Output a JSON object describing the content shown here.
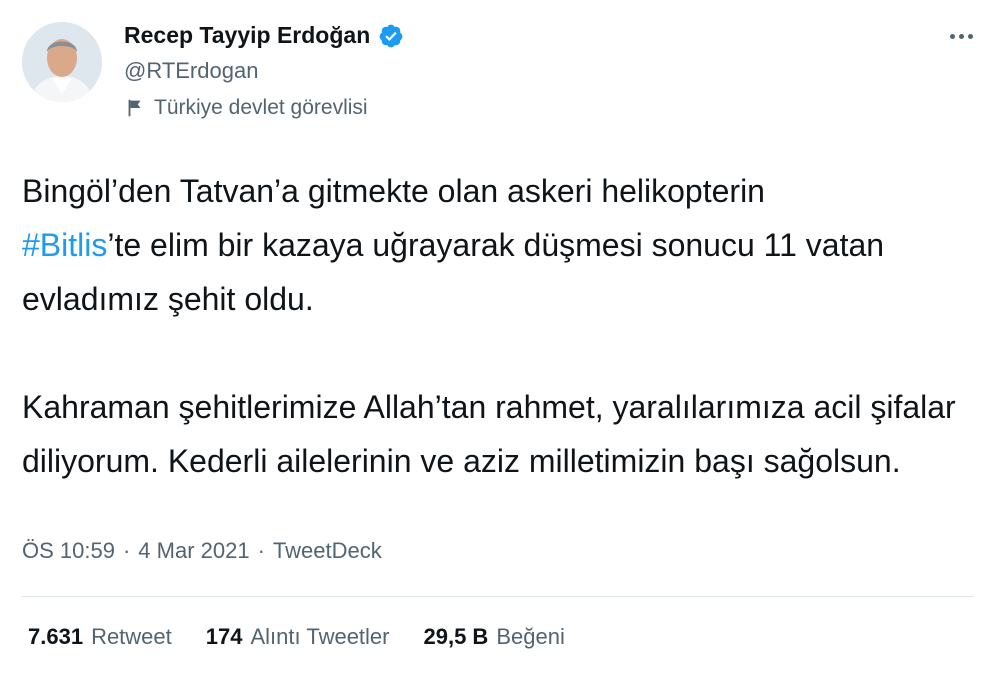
{
  "author": {
    "display_name": "Recep Tayyip Erdoğan",
    "handle": "@RTErdogan",
    "label": "Türkiye devlet görevlisi",
    "verified_icon": "verified-badge-icon",
    "label_icon": "flag-icon"
  },
  "tweet": {
    "line1_text": "Bingöl’den Tatvan’a gitmekte olan askeri helikopterin",
    "hashtag": "#Bitlis",
    "line2_rest": "’te elim bir kazaya uğrayarak düşmesi sonucu 11 vatan evladımız şehit oldu.",
    "paragraph2": "Kahraman şehitlerimize Allah’tan rahmet, yaralılarımıza acil şifalar diliyorum. Kederli ailelerinin ve aziz milletimizin başı sağolsun."
  },
  "meta": {
    "time": "ÖS 10:59",
    "sep1": "·",
    "date": "4 Mar 2021",
    "sep2": "·",
    "source": "TweetDeck"
  },
  "stats": {
    "retweets_count": "7.631",
    "retweets_label": "Retweet",
    "quotes_count": "174",
    "quotes_label": "Alıntı Tweetler",
    "likes_count": "29,5 B",
    "likes_label": "Beğeni"
  },
  "colors": {
    "accent": "#1d9bf0",
    "text_primary": "#0f1419",
    "text_secondary": "#536471",
    "divider": "#e1e8ed"
  }
}
